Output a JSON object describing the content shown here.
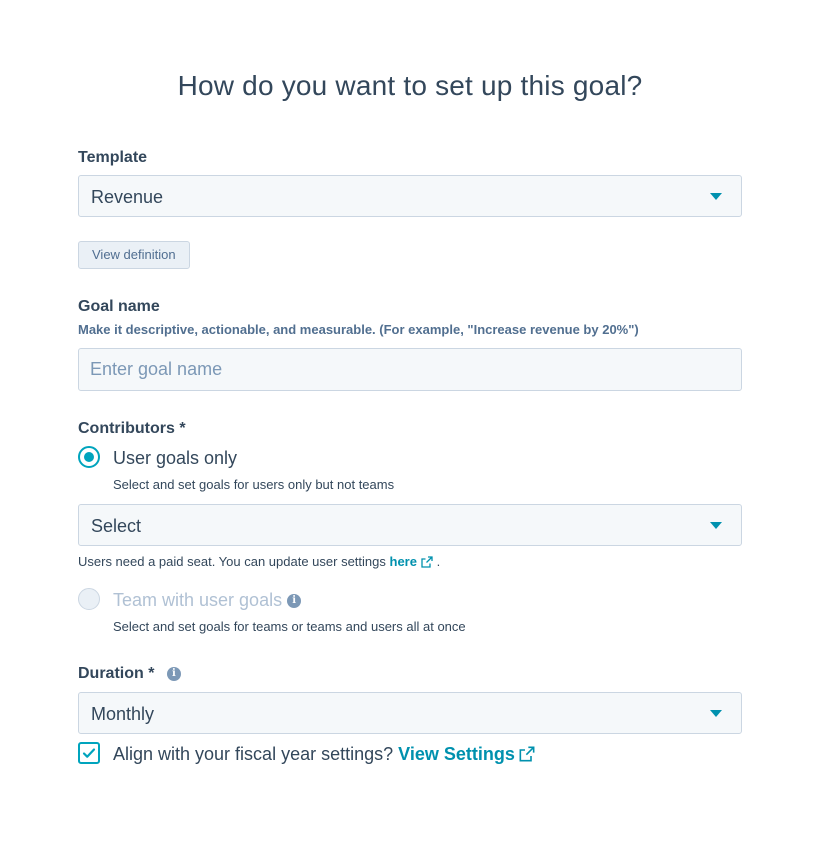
{
  "page": {
    "title": "How do you want to set up this goal?"
  },
  "template": {
    "label": "Template",
    "value": "Revenue",
    "view_definition_label": "View definition"
  },
  "goal_name": {
    "label": "Goal name",
    "help": "Make it descriptive, actionable, and measurable. (For example, \"Increase revenue by 20%\")",
    "value": "",
    "placeholder": "Enter goal name"
  },
  "contributors": {
    "label": "Contributors *",
    "options": [
      {
        "label": "User goals only",
        "description": "Select and set goals for users only but not teams",
        "selected": true,
        "disabled": false
      },
      {
        "label": "Team with user goals",
        "description": "Select and set goals for teams or teams and users all at once",
        "selected": false,
        "disabled": true
      }
    ],
    "user_select_value": "Select",
    "note_prefix": "Users need a paid seat. You can update user settings",
    "note_link": "here",
    "note_suffix": "."
  },
  "duration": {
    "label": "Duration *",
    "value": "Monthly"
  },
  "fiscal": {
    "checked": true,
    "label": "Align with your fiscal year settings?",
    "link": "View Settings"
  },
  "icons": {
    "caret": "chevron-down-icon",
    "info": "info-icon",
    "external": "external-link-icon",
    "check": "check-icon"
  },
  "colors": {
    "accent": "#00a4bd",
    "link": "#0091ae",
    "text": "#33475b",
    "field_bg": "#f5f8fa",
    "field_border": "#cbd6e2"
  }
}
